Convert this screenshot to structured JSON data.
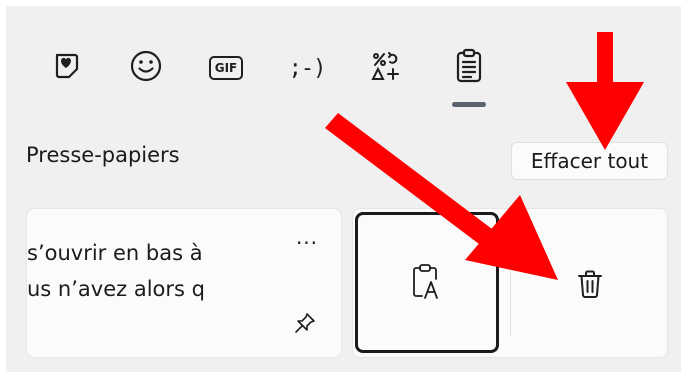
{
  "tabs": [
    {
      "id": "kaomoji-heart",
      "icon": "heart-sticker-icon"
    },
    {
      "id": "emoji",
      "icon": "smiley-icon"
    },
    {
      "id": "gif",
      "icon": "gif-icon",
      "label": "GIF"
    },
    {
      "id": "kaomoji",
      "icon": "kaomoji-icon",
      "label": ";-)"
    },
    {
      "id": "symbols",
      "icon": "symbols-icon"
    },
    {
      "id": "clipboard",
      "icon": "clipboard-icon",
      "active": true
    }
  ],
  "clipboard": {
    "title": "Presse-papiers",
    "clear_all_label": "Effacer tout",
    "items": [
      {
        "line1": "s’ouvrir en bas à",
        "line2": "us n’avez alors q",
        "more_label": "···"
      }
    ]
  },
  "colors": {
    "panel_bg": "#f0f0f0",
    "card_bg": "#fbfbfb",
    "accent_indicator": "#5a6470",
    "annotation_arrow": "#ff0000"
  }
}
